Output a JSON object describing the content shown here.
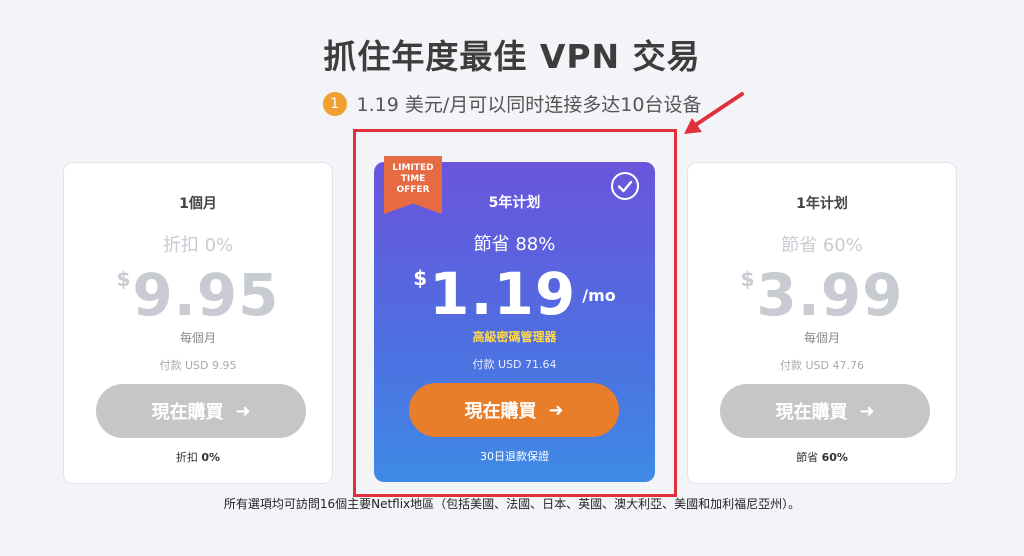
{
  "header": {
    "title": "抓住年度最佳 VPN 交易",
    "step_number": "1",
    "subtitle": "1.19 美元/月可以同时连接多达10台设备"
  },
  "plans": [
    {
      "name": "1個月",
      "discount": "折扣 0%",
      "currency": "$",
      "price": "9.95",
      "per_month": "每個月",
      "paid": "付款 USD 9.95",
      "button": "現在購買",
      "foot_label": "折扣",
      "foot_value": "0%"
    },
    {
      "ribbon": [
        "LIMITED",
        "TIME",
        "OFFER"
      ],
      "name": "5年计划",
      "discount": "節省 88%",
      "currency": "$",
      "price": "1.19",
      "unit": "/mo",
      "extra": "高級密碼管理器",
      "paid": "付款 USD 71.64",
      "button": "現在購買",
      "guarantee": "30日退款保證"
    },
    {
      "name": "1年计划",
      "discount": "節省 60%",
      "currency": "$",
      "price": "3.99",
      "per_month": "每個月",
      "paid": "付款 USD 47.76",
      "button": "現在購買",
      "foot_label": "節省",
      "foot_value": "60%"
    }
  ],
  "footnote": "所有選項均可訪問16個主要Netflix地區（包括美國、法國、日本、英國、澳大利亞、美國和加利福尼亞州）。",
  "colors": {
    "featured_start": "#6a55dc",
    "featured_end": "#3f8ae6",
    "cta_orange": "#e87d2a",
    "disabled_button": "#c6c6c6",
    "highlight_red": "#e0313a",
    "ribbon": "#e66a42"
  },
  "icons": {
    "check": "check-circle-icon",
    "arrow": "arrow-right-icon",
    "annotation": "red-pointer-arrow"
  }
}
